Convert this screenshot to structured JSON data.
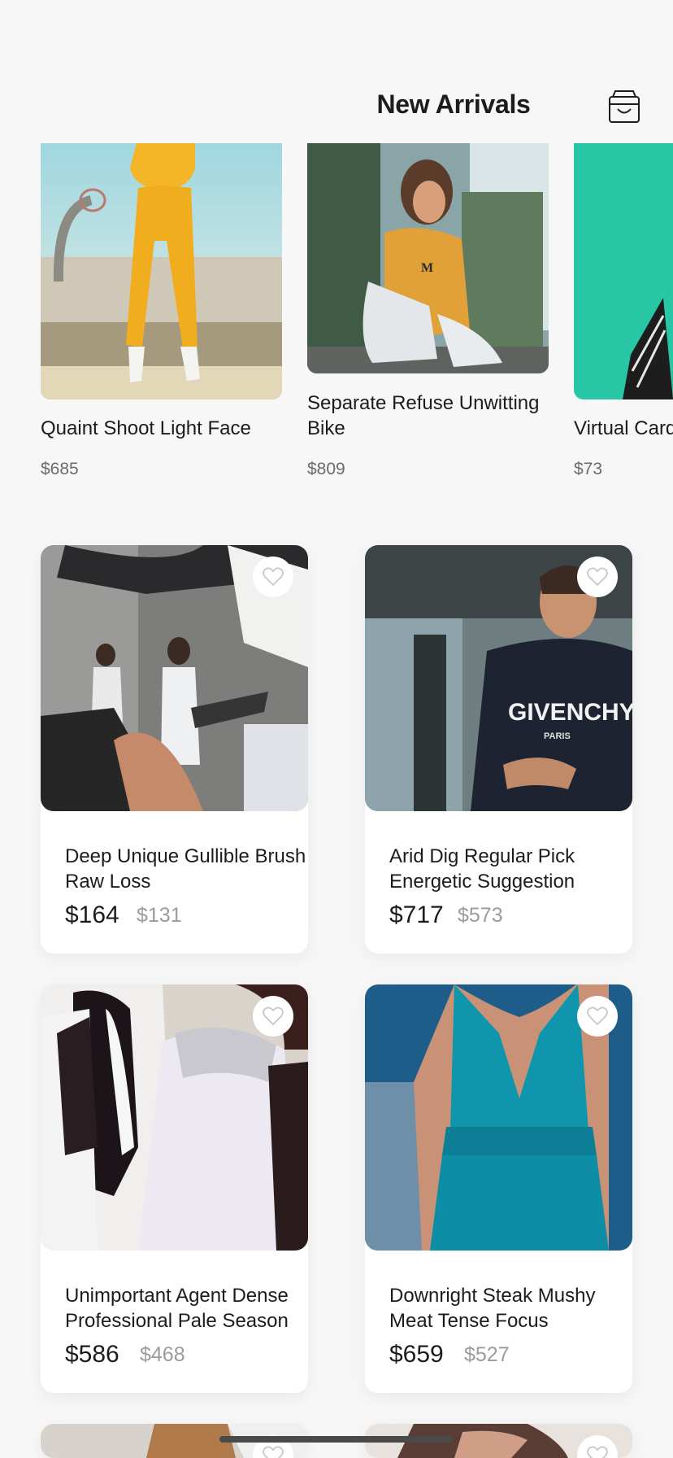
{
  "header": {
    "title": "New Arrivals",
    "cart_icon": "shopping-bag-icon"
  },
  "carousel": [
    {
      "name": "Quaint Shoot Light Face",
      "price": "$685"
    },
    {
      "name": "Separate Refuse Unwitting Bike",
      "price": "$809"
    },
    {
      "name": "Virtual Card",
      "price": "$73"
    }
  ],
  "products": [
    {
      "name": "Deep Unique Gullible Brush Raw Loss",
      "price": "$164",
      "old_price": "$131"
    },
    {
      "name": "Arid Dig Regular Pick Energetic Suggestion",
      "price": "$717",
      "old_price": "$573"
    },
    {
      "name": "Unimportant Agent Dense Professional Pale Season",
      "price": "$586",
      "old_price": "$468"
    },
    {
      "name": "Downright Steak Mushy Meat Tense Focus",
      "price": "$659",
      "old_price": "$527"
    }
  ],
  "colors": {
    "background": "#f7f7f8",
    "text": "#1c1c1e",
    "muted": "#9a9aa0"
  }
}
